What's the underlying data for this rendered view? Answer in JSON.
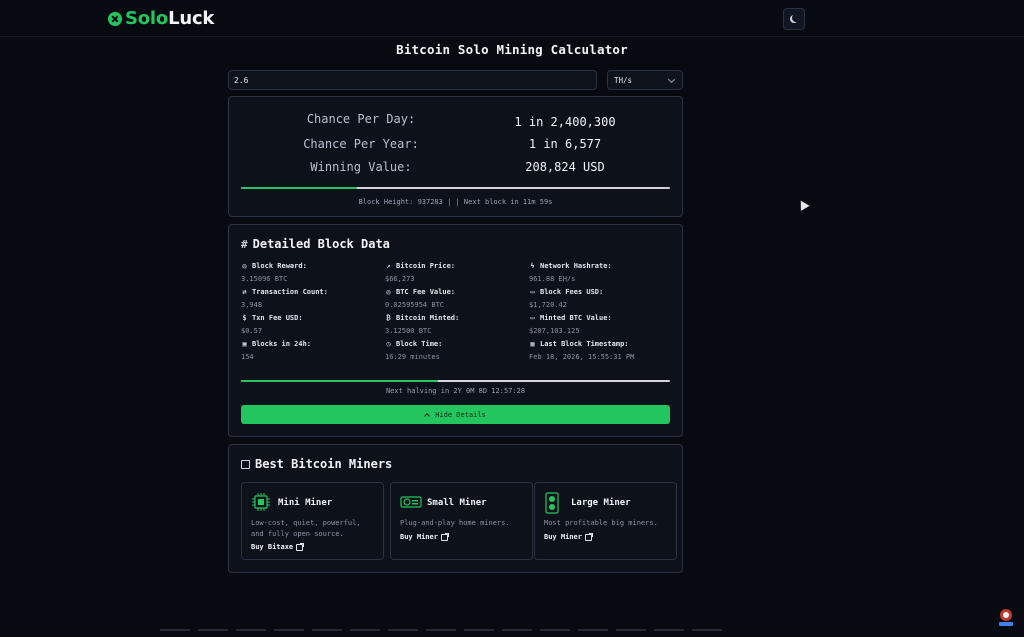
{
  "app": {
    "name_part1": "Solo",
    "name_part2": "Luck"
  },
  "page": {
    "title": "Bitcoin Solo Mining Calculator"
  },
  "input": {
    "hashrate_value": "2.6",
    "unit": "TH/s"
  },
  "stats": {
    "rows": [
      {
        "label": "Chance Per Day:",
        "value": "1 in 2,400,300"
      },
      {
        "label": "Chance Per Year:",
        "value": "1 in 6,577"
      },
      {
        "label": "Winning Value:",
        "value": "208,824 USD"
      }
    ],
    "block_progress": 0.27,
    "block_info": "Block Height: 937283 |  | Next block in 11m 59s"
  },
  "details": {
    "title": "Detailed Block Data",
    "items": [
      {
        "label": "Block Reward:",
        "value": "3.15096 BTC",
        "icon": "coins-icon"
      },
      {
        "label": "Bitcoin Price:",
        "value": "$66,273",
        "icon": "trending-up-icon"
      },
      {
        "label": "Network Hashrate:",
        "value": "961.88 EH/s",
        "icon": "zap-icon"
      },
      {
        "label": "Transaction Count:",
        "value": "3,948",
        "icon": "arrows-icon"
      },
      {
        "label": "BTC Fee Value:",
        "value": "0.02595954 BTC",
        "icon": "coins-icon"
      },
      {
        "label": "Block Fees USD:",
        "value": "$1,720.42",
        "icon": "banknote-icon"
      },
      {
        "label": "Txn Fee USD:",
        "value": "$0.57",
        "icon": "dollar-icon"
      },
      {
        "label": "Bitcoin Minted:",
        "value": "3.12500 BTC",
        "icon": "bitcoin-icon"
      },
      {
        "label": "Minted BTC Value:",
        "value": "$207,103.125",
        "icon": "banknote-icon"
      },
      {
        "label": "Blocks in 24h:",
        "value": "154",
        "icon": "blocks-icon"
      },
      {
        "label": "Block Time:",
        "value": "16:29 minutes",
        "icon": "clock-icon"
      },
      {
        "label": "Last Block Timestamp:",
        "value": "Feb 18, 2026, 15:55:31 PM",
        "icon": "calendar-icon"
      }
    ],
    "halving_progress": 0.46,
    "halving_text": "Next halving in 2Y 0M 8D 12:57:28",
    "hide_label": "Hide Details"
  },
  "miners": {
    "title": "Best Bitcoin Miners",
    "cards": [
      {
        "title": "Mini Miner",
        "desc": "Low-cost, quiet, powerful, and fully open source.",
        "link": "Buy Bitaxe"
      },
      {
        "title": "Small Miner",
        "desc": "Plug-and-play home miners.",
        "link": "Buy Miner"
      },
      {
        "title": "Large Miner",
        "desc": "Most profitable big miners.",
        "link": "Buy Miner"
      }
    ]
  },
  "colors": {
    "accent": "#22c55e",
    "background": "#070a11",
    "card": "#0c111a",
    "border": "#2a3342"
  }
}
